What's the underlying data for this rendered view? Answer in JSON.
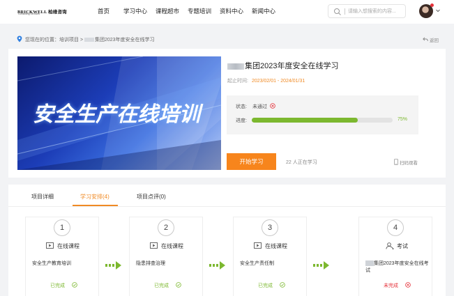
{
  "header": {
    "logo_text": "BRICKWELL 柏维咨询",
    "logo_sub": "Consulting Services",
    "nav": [
      "首页",
      "学习中心",
      "课程超市",
      "专题培训",
      "资料中心",
      "新闻中心"
    ],
    "search_placeholder": "请输入想搜索的内容...",
    "avatar": "avatar-user"
  },
  "breadcrumb": {
    "text": "您现在的位置：培训项目  >  ",
    "current": "集团2023年度安全在线学习",
    "back": "返回"
  },
  "course": {
    "banner_title": "安全生产在线培训",
    "title": "集团2023年度安全在线学习",
    "date_label": "起止时间:",
    "date_value": "2023/02/01 - 2024/01/31",
    "status_label": "状态:",
    "status_value": "未通过",
    "progress_label": "进度:",
    "progress_value": 0.75,
    "progress_text": "75%",
    "start_button": "开始学习",
    "learners": "22 人正在学习",
    "scan": "扫码观看",
    "colors": {
      "accent": "#f7851c",
      "progress": "#7cb82f",
      "fail": "#e5323b"
    }
  },
  "tabs": [
    "项目详细",
    "学习安排(4)",
    "项目点评(0)"
  ],
  "active_tab": 1,
  "steps": [
    {
      "num": "1",
      "type": "在线课程",
      "icon": "video-icon",
      "name": "安全生产教育培训",
      "state": "已完成",
      "done": true
    },
    {
      "num": "2",
      "type": "在线课程",
      "icon": "video-icon",
      "name": "隐患排查治理",
      "state": "已完成",
      "done": true
    },
    {
      "num": "3",
      "type": "在线课程",
      "icon": "video-icon",
      "name": "安全生产责任制",
      "state": "已完成",
      "done": true
    },
    {
      "num": "4",
      "type": "考试",
      "icon": "exam-user-icon",
      "name": "集团2023年度安全在线考试",
      "state": "未完成",
      "done": false
    }
  ]
}
